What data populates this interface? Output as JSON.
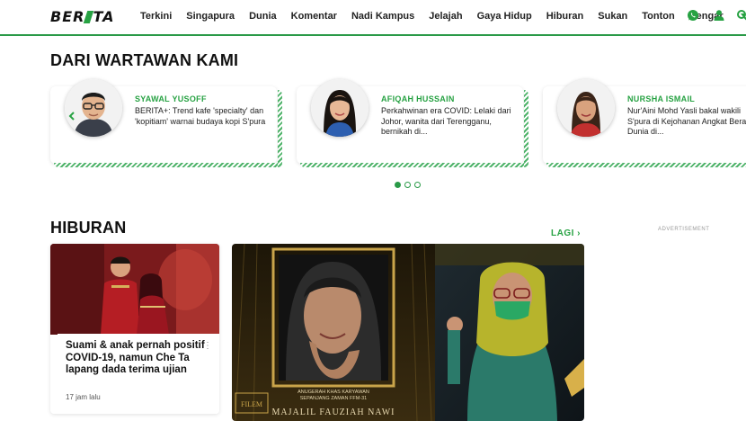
{
  "nav": {
    "logo_left": "BER",
    "logo_right": "TA",
    "items": [
      "Terkini",
      "Singapura",
      "Dunia",
      "Komentar",
      "Nadi Kampus",
      "Jelajah",
      "Gaya Hidup",
      "Hiburan",
      "Sukan",
      "Tonton",
      "Dengar"
    ],
    "icons": [
      "whatsapp-icon",
      "user-icon",
      "search-icon"
    ],
    "accent": "#27a243"
  },
  "wartawan": {
    "title": "DARI WARTAWAN KAMI",
    "cards": [
      {
        "name": "SYAWAL YUSOFF",
        "text": "BERITA+: Trend kafe 'specialty' dan 'kopitiam' warnai budaya kopi S'pura"
      },
      {
        "name": "AFIQAH HUSSAIN",
        "text": "Perkahwinan era COVID: Lelaki dari Johor, wanita dari Terengganu, bernikah di..."
      },
      {
        "name": "NURSHA ISMAIL",
        "text": "Nur'Aini Mohd Yasli bakal wakili S'pura di Kejohanan Angkat Berat Dunia di..."
      }
    ],
    "dots": 3,
    "active_dot": 0
  },
  "hiburan": {
    "title": "HIBURAN",
    "more_label": "LAGI",
    "ad_label": "ADVERTISEMENT",
    "story": {
      "title": "Suami & anak pernah positif COVID-19, namun Che Ta lapang dada terima ujian",
      "time": "17 jam lalu"
    },
    "feature": {
      "caption_1": "ANUGERAH KHAS KARYAWAN",
      "caption_2": "SEPANJANG ZAMAN FFM-31",
      "caption_3": "MAJALIL FAUZIAH NAWI",
      "logo_text": "FILEM"
    }
  }
}
